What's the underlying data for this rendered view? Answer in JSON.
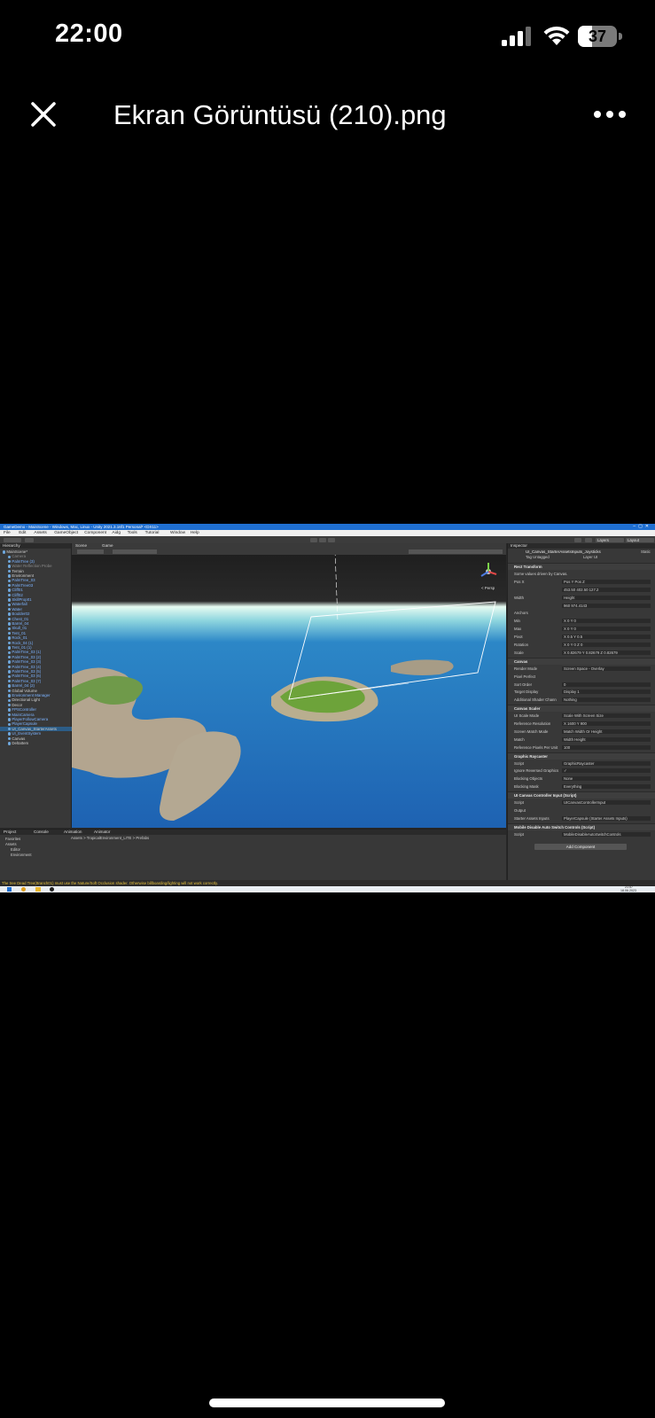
{
  "status_bar": {
    "time": "22:00",
    "battery": "37",
    "battery_level": 0.37
  },
  "viewer": {
    "title": "Ekran Görüntüsü (210).png"
  },
  "screenshot": {
    "window_title": "GameDemo - MainScene - Windows, Mac, Linux - Unity 2021.3.16f1 Personal* <DX11>",
    "menu": [
      "File",
      "Edit",
      "Assets",
      "GameObject",
      "Component",
      "Aidg",
      "Tools",
      "Tutorial",
      "Window",
      "Help"
    ],
    "toolbar": {
      "layers": "Layers",
      "layout": "Layout"
    },
    "hierarchy": {
      "tab": "Hierarchy",
      "rows": [
        {
          "label": "MainScene*",
          "style": ""
        },
        {
          "label": "Camera",
          "style": "dim"
        },
        {
          "label": "PalmTree (3)",
          "style": "blue"
        },
        {
          "label": "Water Reflection Probe",
          "style": "dim"
        },
        {
          "label": "Terrain",
          "style": ""
        },
        {
          "label": "Environment",
          "style": ""
        },
        {
          "label": "PalmTree_03",
          "style": "blue"
        },
        {
          "label": "PalmTree03",
          "style": "blue"
        },
        {
          "label": "Cliff01",
          "style": "blue"
        },
        {
          "label": "Cliff02",
          "style": "blue"
        },
        {
          "label": "SkillProp01",
          "style": "blue"
        },
        {
          "label": "Waterfall",
          "style": "blue"
        },
        {
          "label": "Water",
          "style": "blue"
        },
        {
          "label": "Boulder02",
          "style": "blue"
        },
        {
          "label": "Chest_01",
          "style": "blue"
        },
        {
          "label": "Barrel_04",
          "style": "blue"
        },
        {
          "label": "Skull_01",
          "style": "blue"
        },
        {
          "label": "Tent_01",
          "style": "blue"
        },
        {
          "label": "Rock_01",
          "style": "blue"
        },
        {
          "label": "Rock_04 (1)",
          "style": "blue"
        },
        {
          "label": "Tent_01 (1)",
          "style": "blue"
        },
        {
          "label": "PalmTree_03 (1)",
          "style": "blue"
        },
        {
          "label": "PalmTree_03 (2)",
          "style": "blue"
        },
        {
          "label": "PalmTree_03 (3)",
          "style": "blue"
        },
        {
          "label": "PalmTree_03 (4)",
          "style": "blue"
        },
        {
          "label": "PalmTree_03 (5)",
          "style": "blue"
        },
        {
          "label": "PalmTree_03 (6)",
          "style": "blue"
        },
        {
          "label": "PalmTree_03 (7)",
          "style": "blue"
        },
        {
          "label": "Barrel_04 (2)",
          "style": "blue"
        },
        {
          "label": "Global Volume",
          "style": ""
        },
        {
          "label": "Environment Manager",
          "style": "blue"
        },
        {
          "label": "Directional Light",
          "style": ""
        },
        {
          "label": "Decor",
          "style": ""
        },
        {
          "label": "FPSController",
          "style": "blue"
        },
        {
          "label": "MainCamera",
          "style": "blue"
        },
        {
          "label": "PlayerFollowCamera",
          "style": "blue"
        },
        {
          "label": "PlayerCapsule",
          "style": "blue"
        },
        {
          "label": "UI_Canvas_StarterAssets",
          "style": "sel"
        },
        {
          "label": "UI_EventSystem",
          "style": "blue"
        },
        {
          "label": "Canvas",
          "style": ""
        },
        {
          "label": "DeltaItem",
          "style": ""
        }
      ]
    },
    "scene": {
      "tabs": [
        "Scene",
        "Game"
      ],
      "persp": "< Persp"
    },
    "inspector": {
      "tab": "Inspector",
      "object": "UI_Canvas_StarterAssetsInputs_Joysticks",
      "tag": "Untagged",
      "layer": "UI",
      "static": "Static",
      "rows": [
        {
          "type": "sect",
          "label": "Rect Transform"
        },
        {
          "type": "field",
          "label": "Some values driven by Canvas.",
          "value": ""
        },
        {
          "type": "field",
          "label": "Pos X",
          "value": "Pos Y      Pos Z"
        },
        {
          "type": "field",
          "label": "",
          "value": "453.50     402.50     127.2"
        },
        {
          "type": "field",
          "label": "Width",
          "value": "Height"
        },
        {
          "type": "field",
          "label": "",
          "value": "960        974.4143"
        },
        {
          "type": "field",
          "label": "Anchors",
          "value": ""
        },
        {
          "type": "field",
          "label": "Min",
          "value": "X 0        Y 0"
        },
        {
          "type": "field",
          "label": "Max",
          "value": "X 0        Y 0"
        },
        {
          "type": "field",
          "label": "Pivot",
          "value": "X 0.5      Y 0.5"
        },
        {
          "type": "field",
          "label": "Rotation",
          "value": "X 0    Y 0    Z 0"
        },
        {
          "type": "field",
          "label": "Scale",
          "value": "X 0.82679  Y 0.82679  Z 0.82679"
        },
        {
          "type": "sect",
          "label": "Canvas"
        },
        {
          "type": "field",
          "label": "Render Mode",
          "value": "Screen Space - Overlay"
        },
        {
          "type": "field",
          "label": "Pixel Perfect",
          "value": ""
        },
        {
          "type": "field",
          "label": "Sort Order",
          "value": "0"
        },
        {
          "type": "field",
          "label": "Target Display",
          "value": "Display 1"
        },
        {
          "type": "field",
          "label": "Additional Shader Chann",
          "value": "Nothing"
        },
        {
          "type": "sect",
          "label": "Canvas Scaler"
        },
        {
          "type": "field",
          "label": "UI Scale Mode",
          "value": "Scale With Screen Size"
        },
        {
          "type": "field",
          "label": "Reference Resolution",
          "value": "X 1600    Y 900"
        },
        {
          "type": "field",
          "label": "Screen Match Mode",
          "value": "Match Width Or Height"
        },
        {
          "type": "field",
          "label": "Match",
          "value": "Width                    Height"
        },
        {
          "type": "field",
          "label": "Reference Pixels Per Unit",
          "value": "100"
        },
        {
          "type": "sect",
          "label": "Graphic Raycaster"
        },
        {
          "type": "field",
          "label": "Script",
          "value": "GraphicRaycaster"
        },
        {
          "type": "field",
          "label": "Ignore Reversed Graphics",
          "value": "✓"
        },
        {
          "type": "field",
          "label": "Blocking Objects",
          "value": "None"
        },
        {
          "type": "field",
          "label": "Blocking Mask",
          "value": "Everything"
        },
        {
          "type": "sect",
          "label": "UI Canvas Controller Input (Script)"
        },
        {
          "type": "field",
          "label": "Script",
          "value": "UICanvasControllerInput"
        },
        {
          "type": "field",
          "label": "Output",
          "value": ""
        },
        {
          "type": "field",
          "label": "Starter Assets Inputs",
          "value": "PlayerCapsule (Starter Assets Inputs)"
        },
        {
          "type": "sect",
          "label": "Mobile Disable Auto Switch Controls (Script)"
        },
        {
          "type": "field",
          "label": "Script",
          "value": "MobileDisableAutoSwitchControls"
        }
      ],
      "add_component": "Add Component"
    },
    "project": {
      "tabs": [
        "Project",
        "Console",
        "Animation",
        "Animator"
      ],
      "breadcrumb": "Assets > TropicalEnvironment_LITE > Prefabs",
      "tree": [
        "Favorites",
        "Assets",
        "Editor",
        "Environment"
      ]
    },
    "console_msg": "The tree Dead Tree(Branch01) must use the Nature/Soft Occlusion shader. Otherwise billboarding/lighting will not work correctly.",
    "taskbar": {
      "time": "21:57",
      "date": "18.06.2023"
    }
  }
}
